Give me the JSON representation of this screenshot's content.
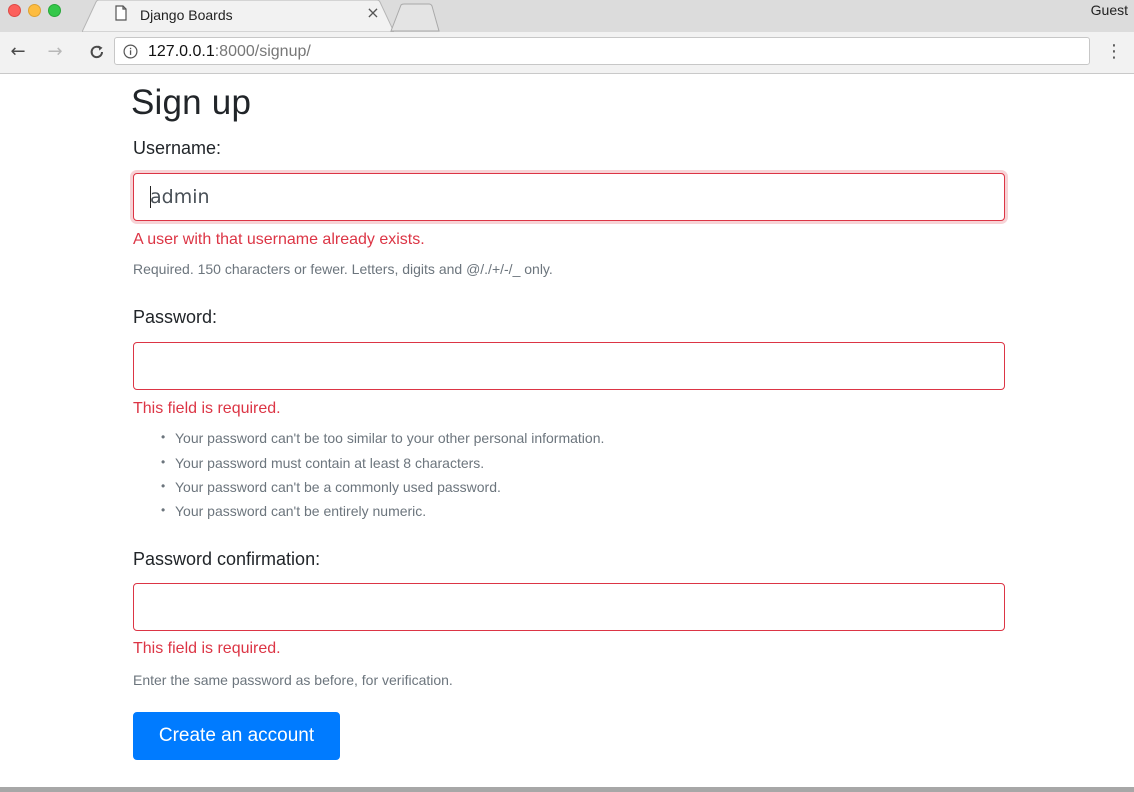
{
  "browser": {
    "tab_title": "Django Boards",
    "tab_close": "×",
    "profile": "Guest",
    "url_host": "127.0.0.1",
    "url_rest": ":8000/signup/",
    "back_glyph": "←",
    "forward_glyph": "→",
    "reload_glyph": "C",
    "menu_glyph": "⋮"
  },
  "page": {
    "title": "Sign up",
    "username": {
      "label": "Username:",
      "value": "admin",
      "error": "A user with that username already exists.",
      "help": "Required. 150 characters or fewer. Letters, digits and @/./+/-/_ only."
    },
    "password1": {
      "label": "Password:",
      "value": "",
      "error": "This field is required.",
      "help_items": [
        "Your password can't be too similar to your other personal information.",
        "Your password must contain at least 8 characters.",
        "Your password can't be a commonly used password.",
        "Your password can't be entirely numeric."
      ]
    },
    "password2": {
      "label": "Password confirmation:",
      "value": "",
      "error": "This field is required.",
      "help": "Enter the same password as before, for verification."
    },
    "submit_label": "Create an account"
  },
  "colors": {
    "error": "#dc3545",
    "primary": "#007bff",
    "muted": "#6c757d"
  }
}
